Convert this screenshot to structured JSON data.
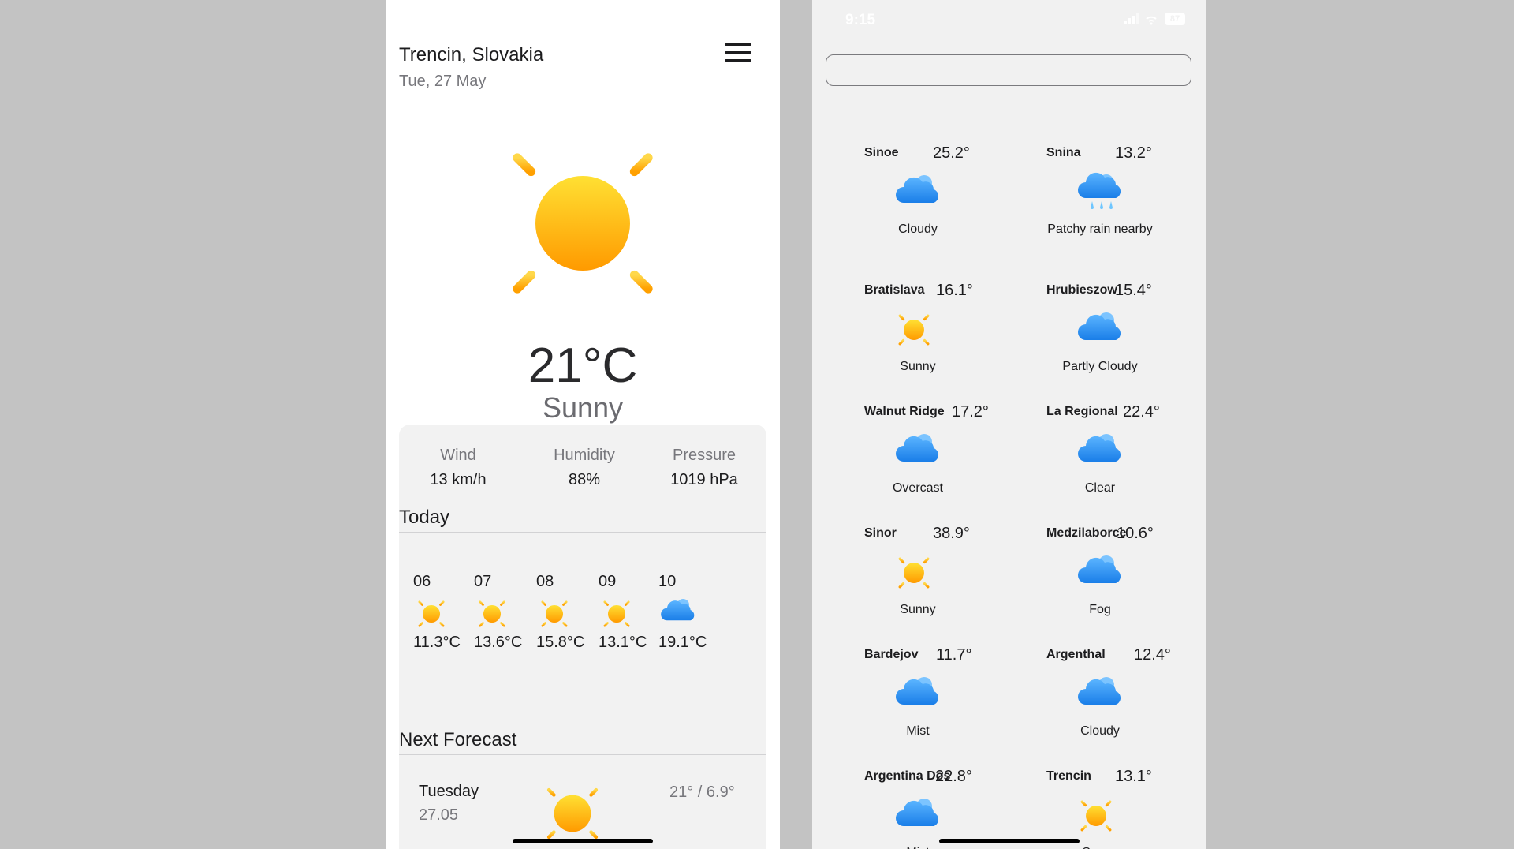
{
  "left": {
    "city": "Trencin, Slovakia",
    "date": "Tue, 27 May",
    "current": {
      "temp": "21°C",
      "condition": "Sunny",
      "icon": "sun-icon"
    },
    "stats": [
      {
        "label": "Wind",
        "value": "13 km/h"
      },
      {
        "label": "Humidity",
        "value": "88%"
      },
      {
        "label": "Pressure",
        "value": "1019 hPa"
      }
    ],
    "today_title": "Today",
    "hourly": [
      {
        "hour": "06",
        "icon": "sun-icon",
        "temp": "11.3°C"
      },
      {
        "hour": "07",
        "icon": "sun-icon",
        "temp": "13.6°C"
      },
      {
        "hour": "08",
        "icon": "sun-icon",
        "temp": "15.8°C"
      },
      {
        "hour": "09",
        "icon": "sun-icon",
        "temp": "13.1°C"
      },
      {
        "hour": "10",
        "icon": "cloud-icon",
        "temp": "19.1°C"
      }
    ],
    "next_title": "Next Forecast",
    "forecast": [
      {
        "day": "Tuesday",
        "date": "27.05",
        "range": "21° / 6.9°",
        "icon": "sun-icon"
      }
    ]
  },
  "right": {
    "status": {
      "time": "9:15",
      "battery": "87"
    },
    "search": {
      "value": "",
      "placeholder": ""
    },
    "cities": [
      {
        "name": "Sinoe",
        "temp": "25.2°",
        "condition": "Cloudy",
        "icon": "cloud-icon"
      },
      {
        "name": "Snina",
        "temp": "13.2°",
        "condition": "Patchy rain nearby",
        "icon": "rain-cloud-icon"
      },
      {
        "name": "Bratislava",
        "temp": "16.1°",
        "condition": "Sunny",
        "icon": "sun-icon"
      },
      {
        "name": "Hrubieszow",
        "temp": "15.4°",
        "condition": "Partly Cloudy",
        "icon": "cloud-icon"
      },
      {
        "name": "Walnut Ridge",
        "temp": "17.2°",
        "condition": "Overcast",
        "icon": "cloud-icon"
      },
      {
        "name": "La Regional",
        "temp": "22.4°",
        "condition": "Clear",
        "icon": "cloud-icon"
      },
      {
        "name": "Sinor",
        "temp": "38.9°",
        "condition": "Sunny",
        "icon": "sun-icon"
      },
      {
        "name": "Medzilaborce",
        "temp": "10.6°",
        "condition": "Fog",
        "icon": "cloud-icon"
      },
      {
        "name": "Bardejov",
        "temp": "11.7°",
        "condition": "Mist",
        "icon": "cloud-icon"
      },
      {
        "name": "Argenthal",
        "temp": "12.4°",
        "condition": "Cloudy",
        "icon": "cloud-icon"
      },
      {
        "name": "Argentina Dos",
        "temp": "22.8°",
        "condition": "Mist",
        "icon": "cloud-icon"
      },
      {
        "name": "Trencin",
        "temp": "13.1°",
        "condition": "Sunny",
        "icon": "sun-icon"
      }
    ]
  },
  "colors": {
    "sun": "#ffb300",
    "cloud": "#2d8ff0",
    "rain": "#6ec6ff",
    "muted": "#77777c"
  }
}
